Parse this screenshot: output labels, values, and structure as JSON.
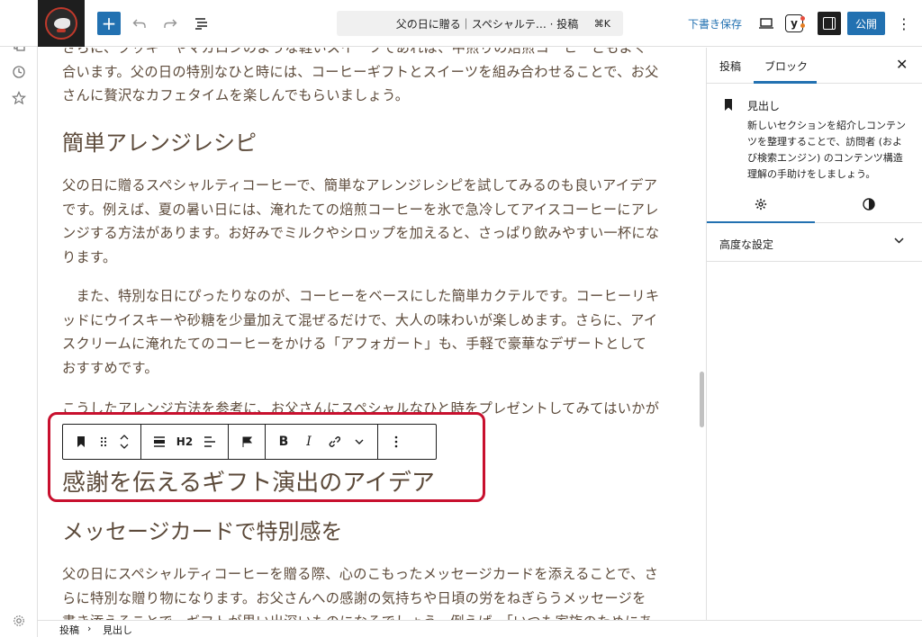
{
  "topbar": {
    "add_label": "+",
    "doc_title": "父の日に贈る｜スペシャルテ… · 投稿",
    "shortcut": "⌘K",
    "save_draft": "下書き保存",
    "publish": "公開",
    "yoast_label": "y"
  },
  "editor": {
    "para1": "さらに、クッキーやマカロンのような軽いスイーツであれば、中煎りの焙煎コーヒーともよく合います。父の日の特別なひと時には、コーヒーギフトとスイーツを組み合わせることで、お父さんに贅沢なカフェタイムを楽しんでもらいましょう。",
    "h2_arrange": "簡単アレンジレシピ",
    "para2": "父の日に贈るスペシャルティコーヒーで、簡単なアレンジレシピを試してみるのも良いアイデアです。例えば、夏の暑い日には、淹れたての焙煎コーヒーを氷で急冷してアイスコーヒーにアレンジする方法があります。お好みでミルクやシロップを加えると、さっぱり飲みやすい一杯になります。",
    "para3": "　また、特別な日にぴったりなのが、コーヒーをベースにした簡単カクテルです。コーヒーリキッドにウイスキーや砂糖を少量加えて混ぜるだけで、大人の味わいが楽しめます。さらに、アイスクリームに淹れたてのコーヒーをかける「アフォガート」も、手軽で豪華なデザートとしておすすめです。",
    "para4": "こうしたアレンジ方法を参考に、お父さんにスペシャルなひと時をプレゼントしてみてはいかが",
    "selected_heading": "感謝を伝えるギフト演出のアイデア",
    "h3_message": "メッセージカードで特別感を",
    "para5": "父の日にスペシャルティコーヒーを贈る際、心のこもったメッセージカードを添えることで、さらに特別な贈り物になります。お父さんへの感謝の気持ちや日頃の労をねぎらうメッセージを書き添えることで、ギフトが思い出深いものになるでしょう。例えば、「いつも家族のためにあり"
  },
  "block_toolbar": {
    "heading_level": "H2",
    "bold": "B",
    "italic": "I"
  },
  "sidebar": {
    "tab_post": "投稿",
    "tab_block": "ブロック",
    "block_name": "見出し",
    "block_desc": "新しいセクションを紹介しコンテンツを整理することで、訪問者 (および検索エンジン) のコンテンツ構造理解の手助けをしましょう。",
    "advanced": "高度な設定"
  },
  "footer": {
    "crumb1": "投稿",
    "separator": "›",
    "crumb2": "見出し"
  },
  "colors": {
    "accent": "#2271b1",
    "text_brown": "#5c4a3a",
    "highlight": "#c8102e"
  }
}
